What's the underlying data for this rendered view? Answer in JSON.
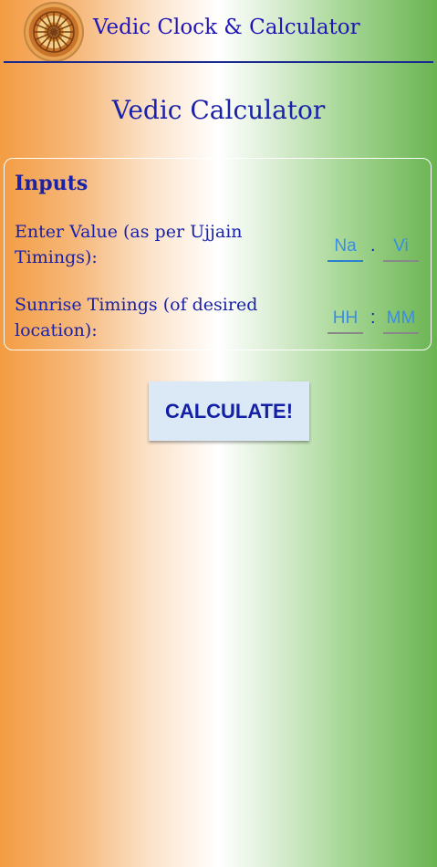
{
  "header": {
    "logo_icon": "dharma-chakra-logo-icon",
    "app_title": "Vedic Clock & Calculator"
  },
  "page": {
    "title": "Vedic Calculator"
  },
  "inputs": {
    "section_title": "Inputs",
    "value_label": "Enter Value (as per Ujjain Timings):",
    "value_fields": [
      {
        "placeholder": "Na"
      },
      {
        "placeholder": "Vi"
      }
    ],
    "value_separator": ".",
    "sunrise_label": "Sunrise Timings (of desired location):",
    "sunrise_fields": [
      {
        "placeholder": "HH"
      },
      {
        "placeholder": "MM"
      }
    ],
    "sunrise_separator": ":"
  },
  "actions": {
    "calculate_label": "CALCULATE!"
  },
  "colors": {
    "saffron": "#f39c43",
    "green": "#6ab451",
    "text_blue": "#1a22a8",
    "hint_blue": "#3b8de0"
  }
}
